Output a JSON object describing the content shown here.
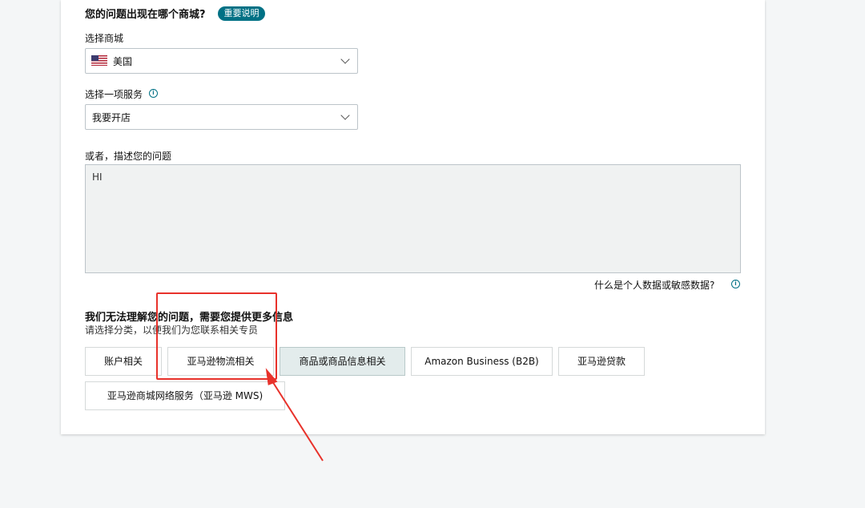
{
  "question": {
    "title": "您的问题出现在哪个商城?",
    "badge": "重要说明"
  },
  "marketplace": {
    "label": "选择商城",
    "value": "美国"
  },
  "service": {
    "label": "选择一项服务",
    "value": "我要开店"
  },
  "description": {
    "label": "或者，描述您的问题",
    "value": "HI"
  },
  "privacy_link": "什么是个人数据或敏感数据?",
  "categories": {
    "title": "我们无法理解您的问题，需要您提供更多信息",
    "subtitle": "请选择分类，以便我们为您联系相关专员",
    "options": [
      {
        "label": "账户相关",
        "selected": false
      },
      {
        "label": "亚马逊物流相关",
        "selected": false
      },
      {
        "label": "商品或商品信息相关",
        "selected": true
      },
      {
        "label": "Amazon Business (B2B)",
        "selected": false
      },
      {
        "label": "亚马逊贷款",
        "selected": false
      },
      {
        "label": "亚马逊商城网络服务（亚马逊 MWS)",
        "selected": false
      }
    ]
  },
  "colors": {
    "accent": "#007185",
    "annotation": "#e8322b",
    "selected_bg": "#e3ecec"
  }
}
